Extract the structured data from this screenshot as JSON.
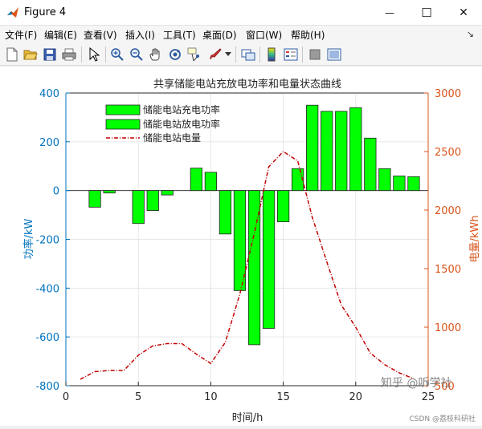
{
  "window": {
    "title": "Figure 4",
    "minimize_glyph": "—",
    "maximize_glyph": "☐",
    "close_glyph": "✕"
  },
  "menu": {
    "items": [
      "文件(F)",
      "编辑(E)",
      "查看(V)",
      "插入(I)",
      "工具(T)",
      "桌面(D)",
      "窗口(W)",
      "帮助(H)"
    ],
    "pin_glyph": "↘"
  },
  "toolbar": {
    "icons": [
      "new-figure-icon",
      "open-file-icon",
      "save-icon",
      "print-icon",
      "pointer-icon",
      "zoom-in-icon",
      "zoom-out-icon",
      "pan-hand-icon",
      "rotate-3d-icon",
      "data-cursor-icon",
      "brush-icon",
      "brush-dropdown-icon",
      "link-plot-icon",
      "colorbar-icon",
      "legend-icon",
      "hide-plot-tools-icon",
      "show-plot-tools-icon"
    ]
  },
  "colors": {
    "bar_fill": "#00ff00",
    "left_axis": "#0072bd",
    "right_axis": "#d95319",
    "line": "#c00000"
  },
  "chart_data": {
    "type": "bar",
    "title": "共享储能电站充放电功率和电量状态曲线",
    "xlabel": "时间/h",
    "ylabel_left": "功率/kW",
    "ylabel_right": "电量/kWh",
    "xlim": [
      0,
      25
    ],
    "xticks": [
      0,
      5,
      10,
      15,
      20,
      25
    ],
    "ylim_left": [
      -800,
      400
    ],
    "yticks_left": [
      -800,
      -600,
      -400,
      -200,
      0,
      200,
      400
    ],
    "ylim_right": [
      500,
      3000
    ],
    "yticks_right": [
      500,
      1000,
      1500,
      2000,
      2500,
      3000
    ],
    "grid": true,
    "legend_placement": "top-left",
    "legend": [
      "储能电站充电功率",
      "储能电站放电功率",
      "储能电站电量"
    ],
    "x": [
      1,
      2,
      3,
      4,
      5,
      6,
      7,
      8,
      9,
      10,
      11,
      12,
      13,
      14,
      15,
      16,
      17,
      18,
      19,
      20,
      21,
      22,
      23,
      24
    ],
    "series": [
      {
        "name": "储能电站充电功率",
        "axis": "left",
        "values": [
          0,
          0,
          0,
          0,
          0,
          0,
          0,
          0,
          92,
          75,
          0,
          0,
          0,
          0,
          0,
          90,
          350,
          325,
          325,
          340,
          215,
          90,
          60,
          57
        ]
      },
      {
        "name": "储能电站放电功率",
        "axis": "left",
        "values": [
          0,
          -68,
          -10,
          0,
          -135,
          -82,
          -18,
          0,
          0,
          0,
          -178,
          -410,
          -632,
          -565,
          -128,
          0,
          0,
          0,
          0,
          0,
          0,
          0,
          0,
          0
        ]
      },
      {
        "name": "储能电站电量",
        "axis": "right",
        "values": [
          555,
          620,
          630,
          630,
          760,
          840,
          860,
          860,
          770,
          690,
          870,
          1280,
          1800,
          2370,
          2500,
          2420,
          1940,
          1560,
          1190,
          1000,
          780,
          680,
          610,
          560
        ]
      }
    ]
  },
  "watermark": {
    "zhihu": "知乎 @听学社",
    "csdn": "CSDN @荔枝科研社"
  }
}
